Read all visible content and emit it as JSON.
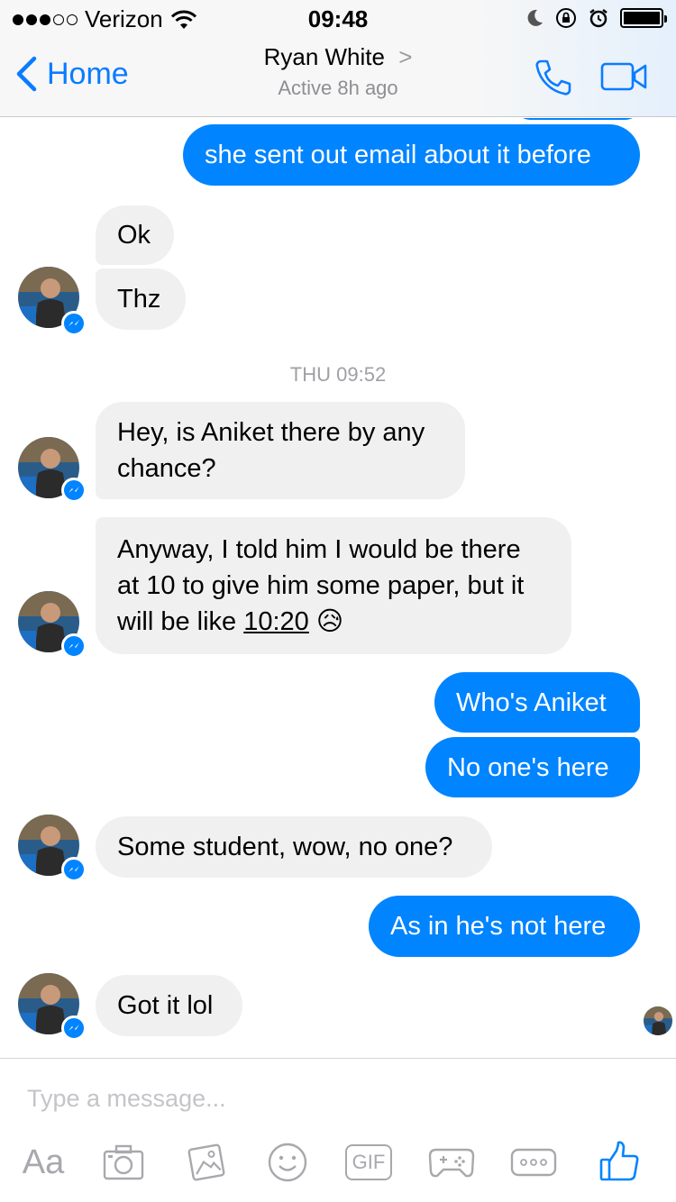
{
  "status_bar": {
    "carrier": "Verizon",
    "time": "09:48",
    "signal_bars_filled": 3,
    "signal_bars_total": 5
  },
  "header": {
    "back_label": "Home",
    "contact_name": "Ryan White",
    "contact_status": "Active 8h ago"
  },
  "messages": [
    {
      "direction": "out",
      "text": "she sent out email about it before"
    },
    {
      "direction": "in",
      "text": "Ok"
    },
    {
      "direction": "in",
      "text": "Thz"
    },
    {
      "direction": "timestamp",
      "text": "THU 09:52"
    },
    {
      "direction": "in",
      "text_lines": [
        "Hey, is Aniket there by any",
        "chance?"
      ]
    },
    {
      "direction": "in",
      "text_lines": [
        "Anyway, I told him I would be there",
        "at 10 to give him some paper, but it",
        "will be like "
      ],
      "link_text": "10:20",
      "emoji": "😥"
    },
    {
      "direction": "out",
      "text": "Who's Aniket"
    },
    {
      "direction": "out",
      "text": "No one's here"
    },
    {
      "direction": "in",
      "text": "Some student, wow, no one?"
    },
    {
      "direction": "out",
      "text": "As in he's not here"
    },
    {
      "direction": "in",
      "text": "Got it lol"
    }
  ],
  "composer": {
    "placeholder": "Type a message...",
    "aa_label": "Aa",
    "gif_label": "GIF",
    "tools": [
      "text-format-icon",
      "camera-icon",
      "photo-icon",
      "emoji-icon",
      "gif-icon",
      "game-controller-icon",
      "more-icon",
      "thumbs-up-icon"
    ]
  },
  "colors": {
    "accent": "#0084ff",
    "incoming_bubble": "#f1f0f0",
    "ios_blue": "#0a7cff"
  }
}
